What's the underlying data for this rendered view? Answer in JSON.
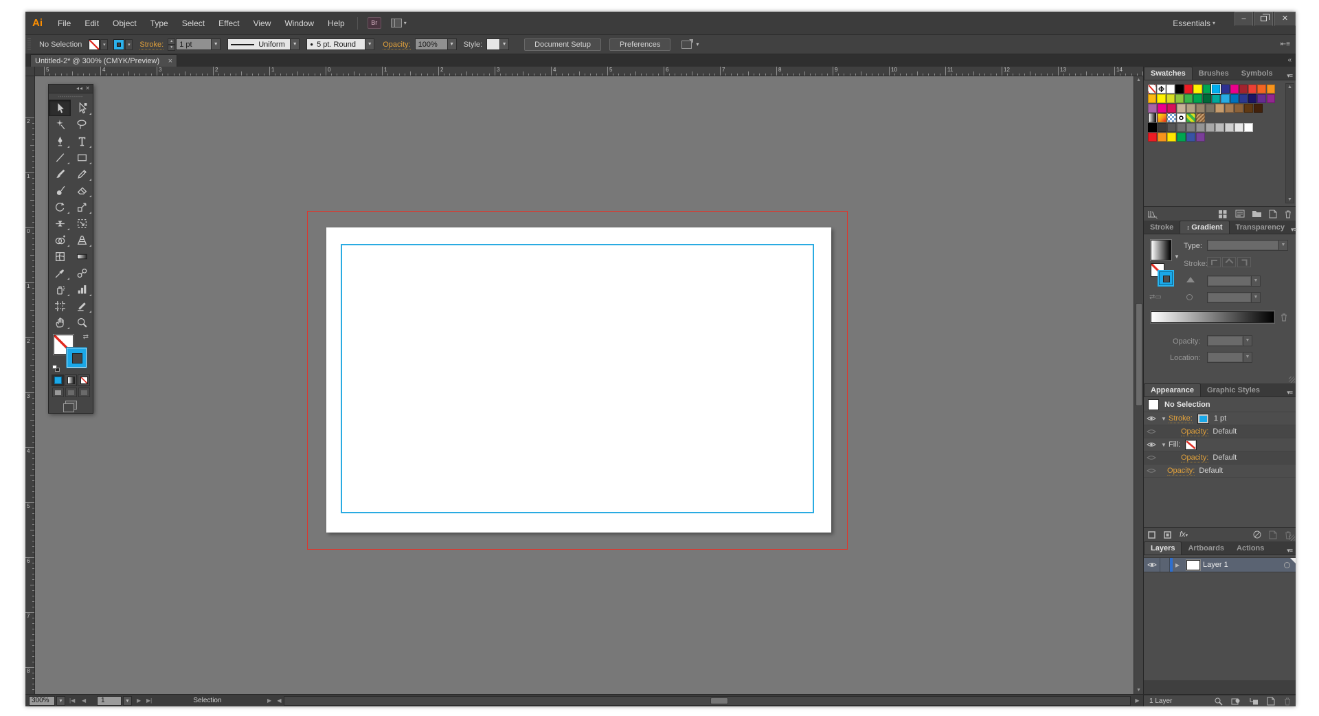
{
  "menubar": {
    "logo": "Ai",
    "items": [
      "File",
      "Edit",
      "Object",
      "Type",
      "Select",
      "Effect",
      "View",
      "Window",
      "Help"
    ],
    "bridge_label": "Br",
    "workspace": "Essentials",
    "window_buttons": {
      "minimize": "–",
      "close": "✕"
    }
  },
  "controlbar": {
    "selection_status": "No Selection",
    "stroke_label": "Stroke:",
    "stroke_weight": "1 pt",
    "variable_width_profile": "Uniform",
    "brush_definition": "5 pt. Round",
    "opacity_label": "Opacity:",
    "opacity_value": "100%",
    "style_label": "Style:",
    "document_setup_label": "Document Setup",
    "preferences_label": "Preferences"
  },
  "document_tab": {
    "title": "Untitled-2* @ 300% (CMYK/Preview)",
    "close_glyph": "×"
  },
  "rulers": {
    "horizontal_labels": [
      "5",
      "4",
      "3",
      "2",
      "1",
      "0",
      "1",
      "2",
      "3",
      "4",
      "5",
      "6",
      "7",
      "8",
      "9",
      "10",
      "11",
      "12",
      "13",
      "14"
    ],
    "vertical_labels": [
      "2",
      "1",
      "0",
      "1",
      "2",
      "3",
      "4",
      "5",
      "6",
      "7",
      "8"
    ]
  },
  "toolbar": {
    "tools": [
      {
        "name": "selection-tool",
        "active": true,
        "flyout": false
      },
      {
        "name": "direct-selection-tool",
        "flyout": true
      },
      {
        "name": "magic-wand-tool",
        "flyout": false
      },
      {
        "name": "lasso-tool",
        "flyout": false
      },
      {
        "name": "pen-tool",
        "flyout": true
      },
      {
        "name": "type-tool",
        "flyout": true
      },
      {
        "name": "line-segment-tool",
        "flyout": true
      },
      {
        "name": "rectangle-tool",
        "flyout": true
      },
      {
        "name": "paintbrush-tool",
        "flyout": false
      },
      {
        "name": "pencil-tool",
        "flyout": true
      },
      {
        "name": "blob-brush-tool",
        "flyout": false
      },
      {
        "name": "eraser-tool",
        "flyout": true
      },
      {
        "name": "rotate-tool",
        "flyout": true
      },
      {
        "name": "scale-tool",
        "flyout": true
      },
      {
        "name": "width-tool",
        "flyout": true
      },
      {
        "name": "free-transform-tool",
        "flyout": false
      },
      {
        "name": "shape-builder-tool",
        "flyout": true
      },
      {
        "name": "perspective-grid-tool",
        "flyout": true
      },
      {
        "name": "mesh-tool",
        "flyout": false
      },
      {
        "name": "gradient-tool",
        "flyout": false
      },
      {
        "name": "eyedropper-tool",
        "flyout": true
      },
      {
        "name": "blend-tool",
        "flyout": false
      },
      {
        "name": "symbol-sprayer-tool",
        "flyout": true
      },
      {
        "name": "column-graph-tool",
        "flyout": true
      },
      {
        "name": "artboard-tool",
        "flyout": false
      },
      {
        "name": "slice-tool",
        "flyout": true
      },
      {
        "name": "hand-tool",
        "flyout": true
      },
      {
        "name": "zoom-tool",
        "flyout": false
      }
    ]
  },
  "canvas": {
    "background": "#787878",
    "artboard_color": "#ffffff",
    "bleed_guide_color": "#e0352b",
    "object_stroke_color": "#29abe2"
  },
  "swatches_panel": {
    "tabs": [
      "Swatches",
      "Brushes",
      "Symbols"
    ],
    "active_tab": "Swatches",
    "rows": [
      [
        "X",
        "R",
        "#ffffff",
        "#000000",
        "#ed1c24",
        "#fff200",
        "#00a651",
        "S#00aeef",
        "#2e3192",
        "#ec008c",
        "#a3232e",
        "#ed4034",
        "#f26522",
        "#f7941d"
      ],
      [
        "#fdb913",
        "#fff200",
        "#d7df23",
        "#8dc63f",
        "#39b54a",
        "#00a651",
        "#006838",
        "#00a99d",
        "#29abe2",
        "#0072bc",
        "#2b3990",
        "#1b1464",
        "#652d90",
        "#92278f"
      ],
      [
        "#a864a8",
        "#ec008c",
        "#d4145a",
        "#c7b299",
        "#b3a284",
        "#98856b",
        "#7d7464",
        "#c69c6d",
        "#a67c52",
        "#8c6239",
        "#603913",
        "#42210b"
      ],
      [
        "G1",
        "G2",
        "P1",
        "P2",
        "P3",
        "P4"
      ],
      [
        "#000000",
        "#3b3b3b",
        "#555555",
        "#6e6e6e",
        "#808080",
        "#949494",
        "#a8a8a8",
        "#bcbcbc",
        "#d0d0d0",
        "#e8e8e8",
        "#ffffff"
      ],
      [
        "#ed1c24",
        "#f7941d",
        "#ffe600",
        "#00a651",
        "#3953a4",
        "#7a3e98"
      ]
    ]
  },
  "gradient_panel": {
    "tabs": [
      "Stroke",
      "Gradient",
      "Transparency"
    ],
    "active_tab": "Gradient",
    "type_label": "Type:",
    "stroke_label": "Stroke:",
    "opacity_label": "Opacity:",
    "location_label": "Location:"
  },
  "appearance_panel": {
    "tabs": [
      "Appearance",
      "Graphic Styles"
    ],
    "active_tab": "Appearance",
    "header": "No Selection",
    "stroke_label": "Stroke:",
    "stroke_value": "1 pt",
    "fill_label": "Fill:",
    "opacity_label": "Opacity:",
    "opacity_value": "Default",
    "fx_label": "fx"
  },
  "layers_panel": {
    "tabs": [
      "Layers",
      "Artboards",
      "Actions"
    ],
    "active_tab": "Layers",
    "layer_name": "Layer 1",
    "count_label": "1 Layer"
  },
  "statusbar": {
    "zoom_level": "300%",
    "artboard_number": "1",
    "status_text": "Selection"
  }
}
